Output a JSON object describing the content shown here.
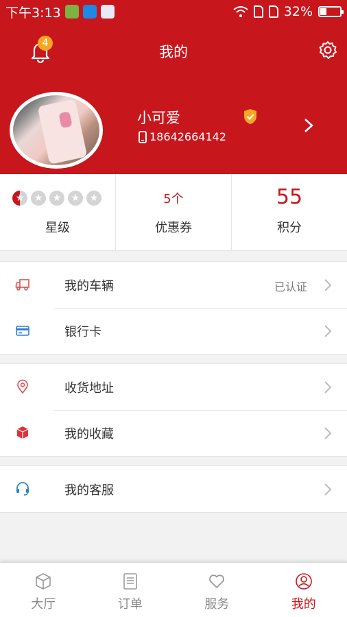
{
  "status_bar": {
    "time": "下午3:13",
    "battery": "32%",
    "battery_level": 0.32
  },
  "header": {
    "title": "我的",
    "notification_count": "4"
  },
  "profile": {
    "name": "小可爱",
    "phone": "18642664142"
  },
  "stats": {
    "stars": {
      "label": "星级",
      "rating": 0.5,
      "max": 5
    },
    "coupons": {
      "value": "5个",
      "label": "优惠券"
    },
    "points": {
      "value": "55",
      "label": "积分"
    }
  },
  "menu": {
    "vehicle": {
      "label": "我的车辆",
      "extra": "已认证"
    },
    "bank_card": {
      "label": "银行卡"
    },
    "address": {
      "label": "收货地址"
    },
    "favorites": {
      "label": "我的收藏"
    },
    "service": {
      "label": "我的客服"
    }
  },
  "tabs": [
    {
      "label": "大厅",
      "icon": "cube-icon"
    },
    {
      "label": "订单",
      "icon": "document-icon"
    },
    {
      "label": "服务",
      "icon": "heart-icon"
    },
    {
      "label": "我的",
      "icon": "user-icon",
      "active": true
    }
  ],
  "colors": {
    "brand": "#c8161d",
    "badge": "#f5a623",
    "verified": "#f5a623"
  }
}
